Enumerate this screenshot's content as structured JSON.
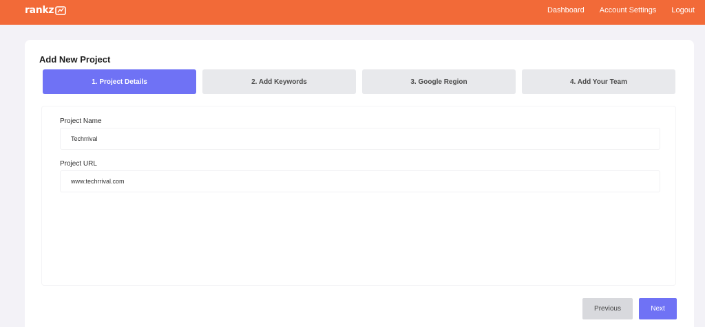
{
  "header": {
    "logo_text": "rankz",
    "logo_icon": "rankz-logo-mark-icon",
    "nav": [
      {
        "label": "Dashboard"
      },
      {
        "label": "Account Settings"
      },
      {
        "label": "Logout"
      }
    ],
    "color": "#f26a38"
  },
  "main": {
    "title": "Add New Project",
    "steps": [
      {
        "label": "1. Project Details",
        "active": true
      },
      {
        "label": "2. Add Keywords",
        "active": false
      },
      {
        "label": "3. Google Region",
        "active": false
      },
      {
        "label": "4. Add Your Team",
        "active": false
      }
    ],
    "form": {
      "project_name": {
        "label": "Project Name",
        "value": "Techrrival"
      },
      "project_url": {
        "label": "Project URL",
        "value": "www.techrrival.com"
      }
    },
    "buttons": {
      "previous": "Previous",
      "next": "Next"
    },
    "accent_color": "#6f72f5"
  }
}
